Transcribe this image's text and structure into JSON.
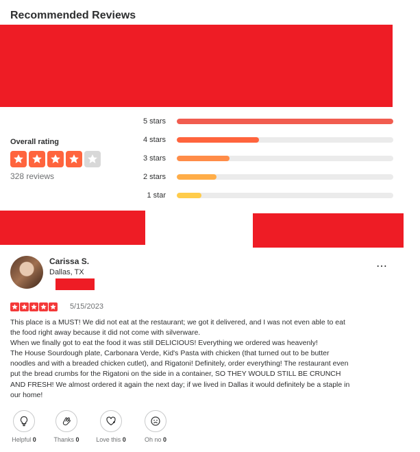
{
  "section": {
    "title": "Recommended Reviews"
  },
  "overall": {
    "label": "Overall rating",
    "stars_filled": 4,
    "stars_total": 5,
    "reviews_count": "328 reviews"
  },
  "distribution": [
    {
      "label": "5 stars",
      "fraction": 1.0,
      "color": "#f15c4f"
    },
    {
      "label": "4 stars",
      "fraction": 0.38,
      "color": "#ff643d"
    },
    {
      "label": "3 stars",
      "fraction": 0.245,
      "color": "#ff8c48"
    },
    {
      "label": "2 stars",
      "fraction": 0.185,
      "color": "#ffad48"
    },
    {
      "label": "1 star",
      "fraction": 0.115,
      "color": "#ffcc4b"
    }
  ],
  "review": {
    "user_name": "Carissa S.",
    "user_location": "Dallas, TX",
    "rating": 5,
    "date": "5/15/2023",
    "text": "This place is a MUST!  We did not eat at the restaurant; we got it delivered, and I was not even able to eat the food right away because it did not come with silverware.\nWhen we finally got to eat the food it was still DELICIOUS!  Everything we ordered was heavenly!\nThe House Sourdough plate, Carbonara Verde, Kid's Pasta with chicken (that turned out to be butter noodles and with a breaded chicken cutlet), and Rigatoni!  Definitely, order everything!  The restaurant even put the bread crumbs for the Rigatoni on the side in a container, SO THEY WOULD STILL BE CRUNCH AND FRESH!  We almost ordered it again the next day; if we lived in Dallas it would definitely be a staple in our home!",
    "more_icon": "⋯"
  },
  "reactions": [
    {
      "label": "Helpful",
      "count": "0",
      "icon": "lightbulb-icon"
    },
    {
      "label": "Thanks",
      "count": "0",
      "icon": "clapping-hands-icon"
    },
    {
      "label": "Love this",
      "count": "0",
      "icon": "heart-icon"
    },
    {
      "label": "Oh no",
      "count": "0",
      "icon": "sad-face-icon"
    }
  ],
  "colors": {
    "star_active": "#ff643d",
    "star_inactive": "#d8d8d8",
    "redaction": "#ee1c25",
    "review_star": "#f43939"
  }
}
